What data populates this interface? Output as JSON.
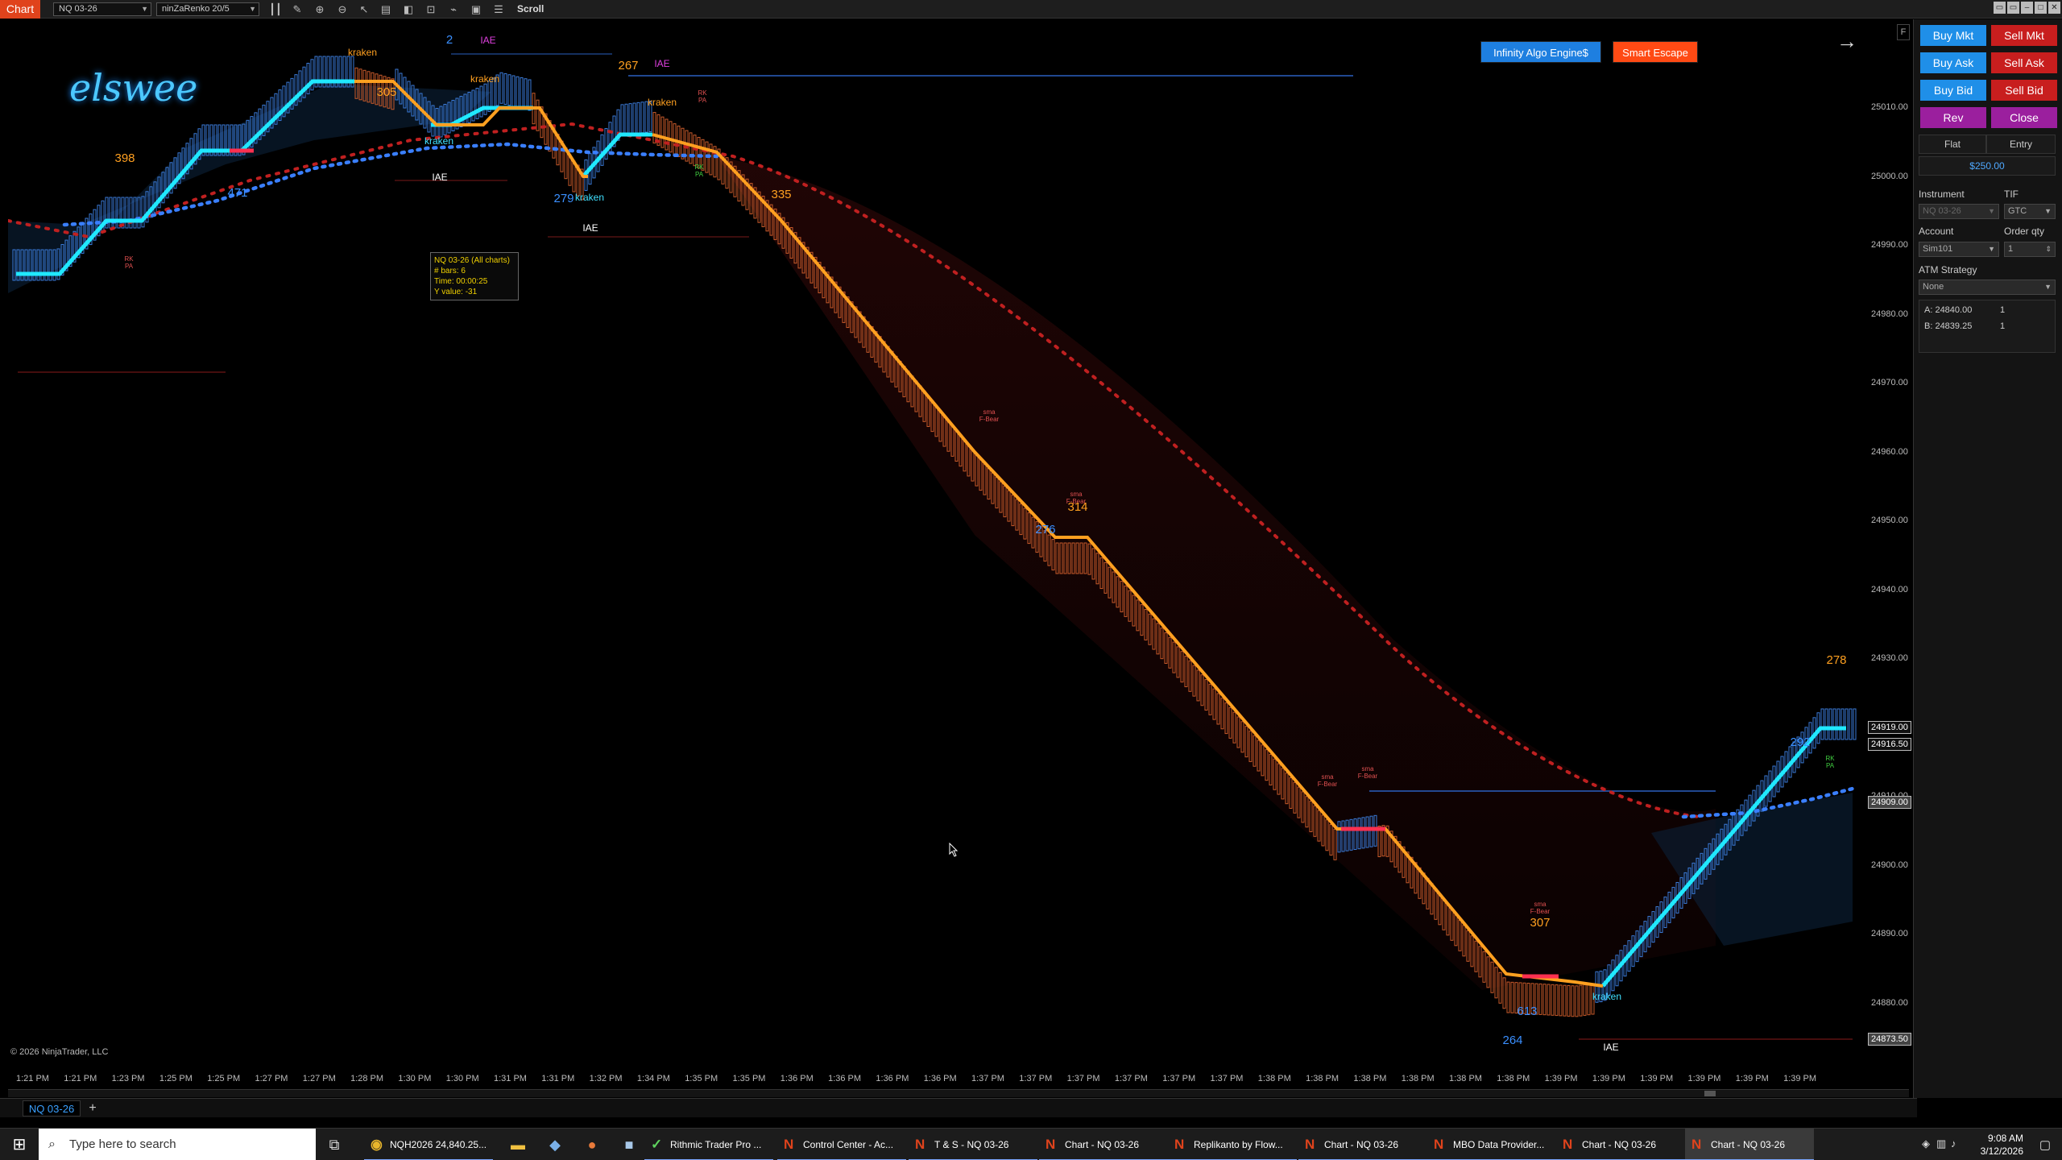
{
  "topbar": {
    "chart_tab": "Chart",
    "instrument": "NQ 03-26",
    "bar_type": "ninZaRenko 20/5",
    "scroll_label": "Scroll"
  },
  "banners": {
    "infinity": "Infinity Algo Engine$",
    "smart_escape": "Smart Escape",
    "infinity_color": "#1e7fe0",
    "smart_color": "#ff4a14"
  },
  "logo_text": "elswee",
  "f_button": "F",
  "annotations": [
    {
      "t": "kraken",
      "c": "#ffa020"
    },
    {
      "t": "2",
      "c": "#3a8fff"
    },
    {
      "t": "IAE",
      "c": "#e040e0"
    },
    {
      "t": "305",
      "c": "#ffa020"
    },
    {
      "t": "kraken",
      "c": "#ffa020"
    },
    {
      "t": "267",
      "c": "#ffa020"
    },
    {
      "t": "IAE",
      "c": "#e040e0"
    },
    {
      "t": "RK PA",
      "c": "#e05050"
    },
    {
      "t": "kraken",
      "c": "#ffa020"
    },
    {
      "t": "398",
      "c": "#ffa020"
    },
    {
      "t": "kraken",
      "c": "#40e0ff"
    },
    {
      "t": "IAE",
      "c": "#ffffff"
    },
    {
      "t": "471",
      "c": "#3a8fff"
    },
    {
      "t": "RK PA",
      "c": "#e05050"
    },
    {
      "t": "279",
      "c": "#3a8fff"
    },
    {
      "t": "kraken",
      "c": "#40e0ff"
    },
    {
      "t": "335",
      "c": "#ffa020"
    },
    {
      "t": "IAE",
      "c": "#ffffff"
    },
    {
      "t": "RK PA",
      "c": "#40d040"
    },
    {
      "t": "sma F-Bear",
      "c": "#e05050"
    },
    {
      "t": "sma F-Bear",
      "c": "#e05050"
    },
    {
      "t": "314",
      "c": "#ffa020"
    },
    {
      "t": "276",
      "c": "#3a8fff"
    },
    {
      "t": "sma F-Bear",
      "c": "#e05050"
    },
    {
      "t": "sma F-Bear",
      "c": "#e05050"
    },
    {
      "t": "sma F-Bear",
      "c": "#e05050"
    },
    {
      "t": "307",
      "c": "#ffa020"
    },
    {
      "t": "613",
      "c": "#3a8fff"
    },
    {
      "t": "264",
      "c": "#3a8fff"
    },
    {
      "t": "kraken",
      "c": "#40e0ff"
    },
    {
      "t": "IAE",
      "c": "#ffffff"
    },
    {
      "t": "278",
      "c": "#ffa020"
    },
    {
      "t": "292",
      "c": "#3a8fff"
    },
    {
      "t": "RK PA",
      "c": "#40d040"
    }
  ],
  "tooltip": {
    "line1": "NQ 03-26 (All charts)",
    "line2": "# bars:   6",
    "line3": "Time:     00:00:25",
    "line4": "Y value:  -31"
  },
  "price_axis": {
    "labels": [
      "25010.00",
      "25000.00",
      "24990.00",
      "24980.00",
      "24970.00",
      "24960.00",
      "24950.00",
      "24940.00",
      "24930.00",
      "24920.00",
      "24910.00",
      "24900.00",
      "24890.00",
      "24880.00"
    ],
    "boxes": [
      "24919.00",
      "24916.50",
      "24909.00",
      "24873.50"
    ]
  },
  "time_axis": [
    "1:21 PM",
    "1:21 PM",
    "1:23 PM",
    "1:25 PM",
    "1:25 PM",
    "1:27 PM",
    "1:27 PM",
    "1:28 PM",
    "1:30 PM",
    "1:30 PM",
    "1:31 PM",
    "1:31 PM",
    "1:32 PM",
    "1:34 PM",
    "1:35 PM",
    "1:35 PM",
    "1:36 PM",
    "1:36 PM",
    "1:36 PM",
    "1:36 PM",
    "1:37 PM",
    "1:37 PM",
    "1:37 PM",
    "1:37 PM",
    "1:37 PM",
    "1:37 PM",
    "1:38 PM",
    "1:38 PM",
    "1:38 PM",
    "1:38 PM",
    "1:38 PM",
    "1:38 PM",
    "1:39 PM",
    "1:39 PM",
    "1:39 PM",
    "1:39 PM",
    "1:39 PM",
    "1:39 PM"
  ],
  "copyright": "© 2026 NinjaTrader, LLC",
  "instrument_tab": "NQ 03-26",
  "add_tab": "+",
  "panel": {
    "buy_mkt": "Buy Mkt",
    "sell_mkt": "Sell Mkt",
    "buy_ask": "Buy Ask",
    "sell_ask": "Sell Ask",
    "buy_bid": "Buy Bid",
    "sell_bid": "Sell Bid",
    "rev": "Rev",
    "close": "Close",
    "flat": "Flat",
    "entry": "Entry",
    "pnl": "$250.00",
    "instrument_label": "Instrument",
    "instrument_value": "NQ 03-26",
    "tif_label": "TIF",
    "tif_value": "GTC",
    "account_label": "Account",
    "account_value": "Sim101",
    "order_qty_label": "Order qty",
    "order_qty_value": "1",
    "atm_label": "ATM Strategy",
    "atm_value": "None",
    "ask_line": "A:  24840.00",
    "ask_qty": "1",
    "bid_line": "B:  24839.25",
    "bid_qty": "1",
    "buy_color": "#1f8fe8",
    "sell_color": "#c81e1e",
    "rev_color": "#9b1f9e"
  },
  "taskbar": {
    "search_placeholder": "Type here to search",
    "apps": [
      "NQH2026 24,840.25...",
      "Rithmic Trader Pro ...",
      "Control Center - Ac...",
      "T & S - NQ 03-26",
      "Chart - NQ 03-26",
      "Replikanto by Flow...",
      "Chart - NQ 03-26",
      "MBO Data Provider...",
      "Chart - NQ 03-26",
      "Chart - NQ 03-26"
    ],
    "time": "9:08 AM",
    "date": "3/12/2026"
  }
}
